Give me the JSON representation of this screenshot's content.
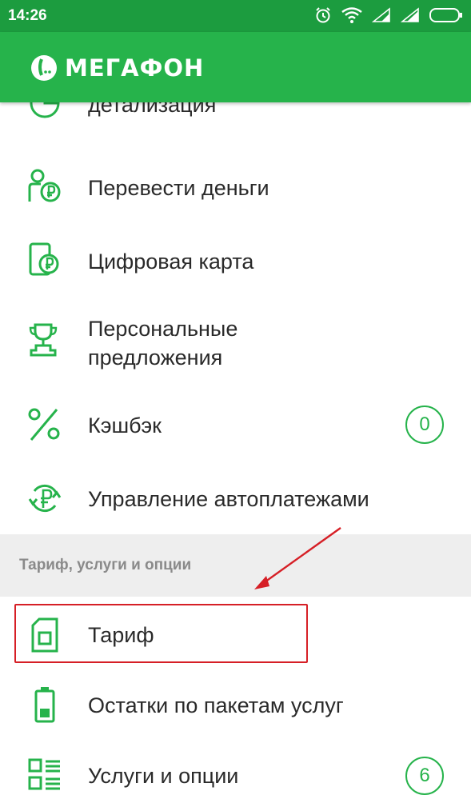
{
  "status_bar": {
    "time": "14:26"
  },
  "brand": {
    "logo_text": "МЕГАФОН",
    "accent": "#26b34b"
  },
  "menu": {
    "items": [
      {
        "label_line1": "детализация",
        "icon": "pie-chart-icon"
      },
      {
        "label": "Перевести деньги",
        "icon": "money-transfer-icon"
      },
      {
        "label": "Цифровая карта",
        "icon": "digital-card-icon"
      },
      {
        "label_line1": "Персональные",
        "label_line2": "предложения",
        "icon": "trophy-icon"
      },
      {
        "label": "Кэшбэк",
        "icon": "percent-icon",
        "badge": "0"
      },
      {
        "label": "Управление автоплатежами",
        "icon": "autopay-icon"
      }
    ],
    "section_title": "Тариф, услуги и опции",
    "section_items": [
      {
        "label": "Тариф",
        "icon": "sim-card-icon"
      },
      {
        "label": "Остатки по пакетам услуг",
        "icon": "battery-icon"
      },
      {
        "label": "Услуги и опции",
        "icon": "services-list-icon",
        "badge": "6"
      }
    ]
  },
  "annotation": {
    "highlight_color": "#d61f26"
  }
}
